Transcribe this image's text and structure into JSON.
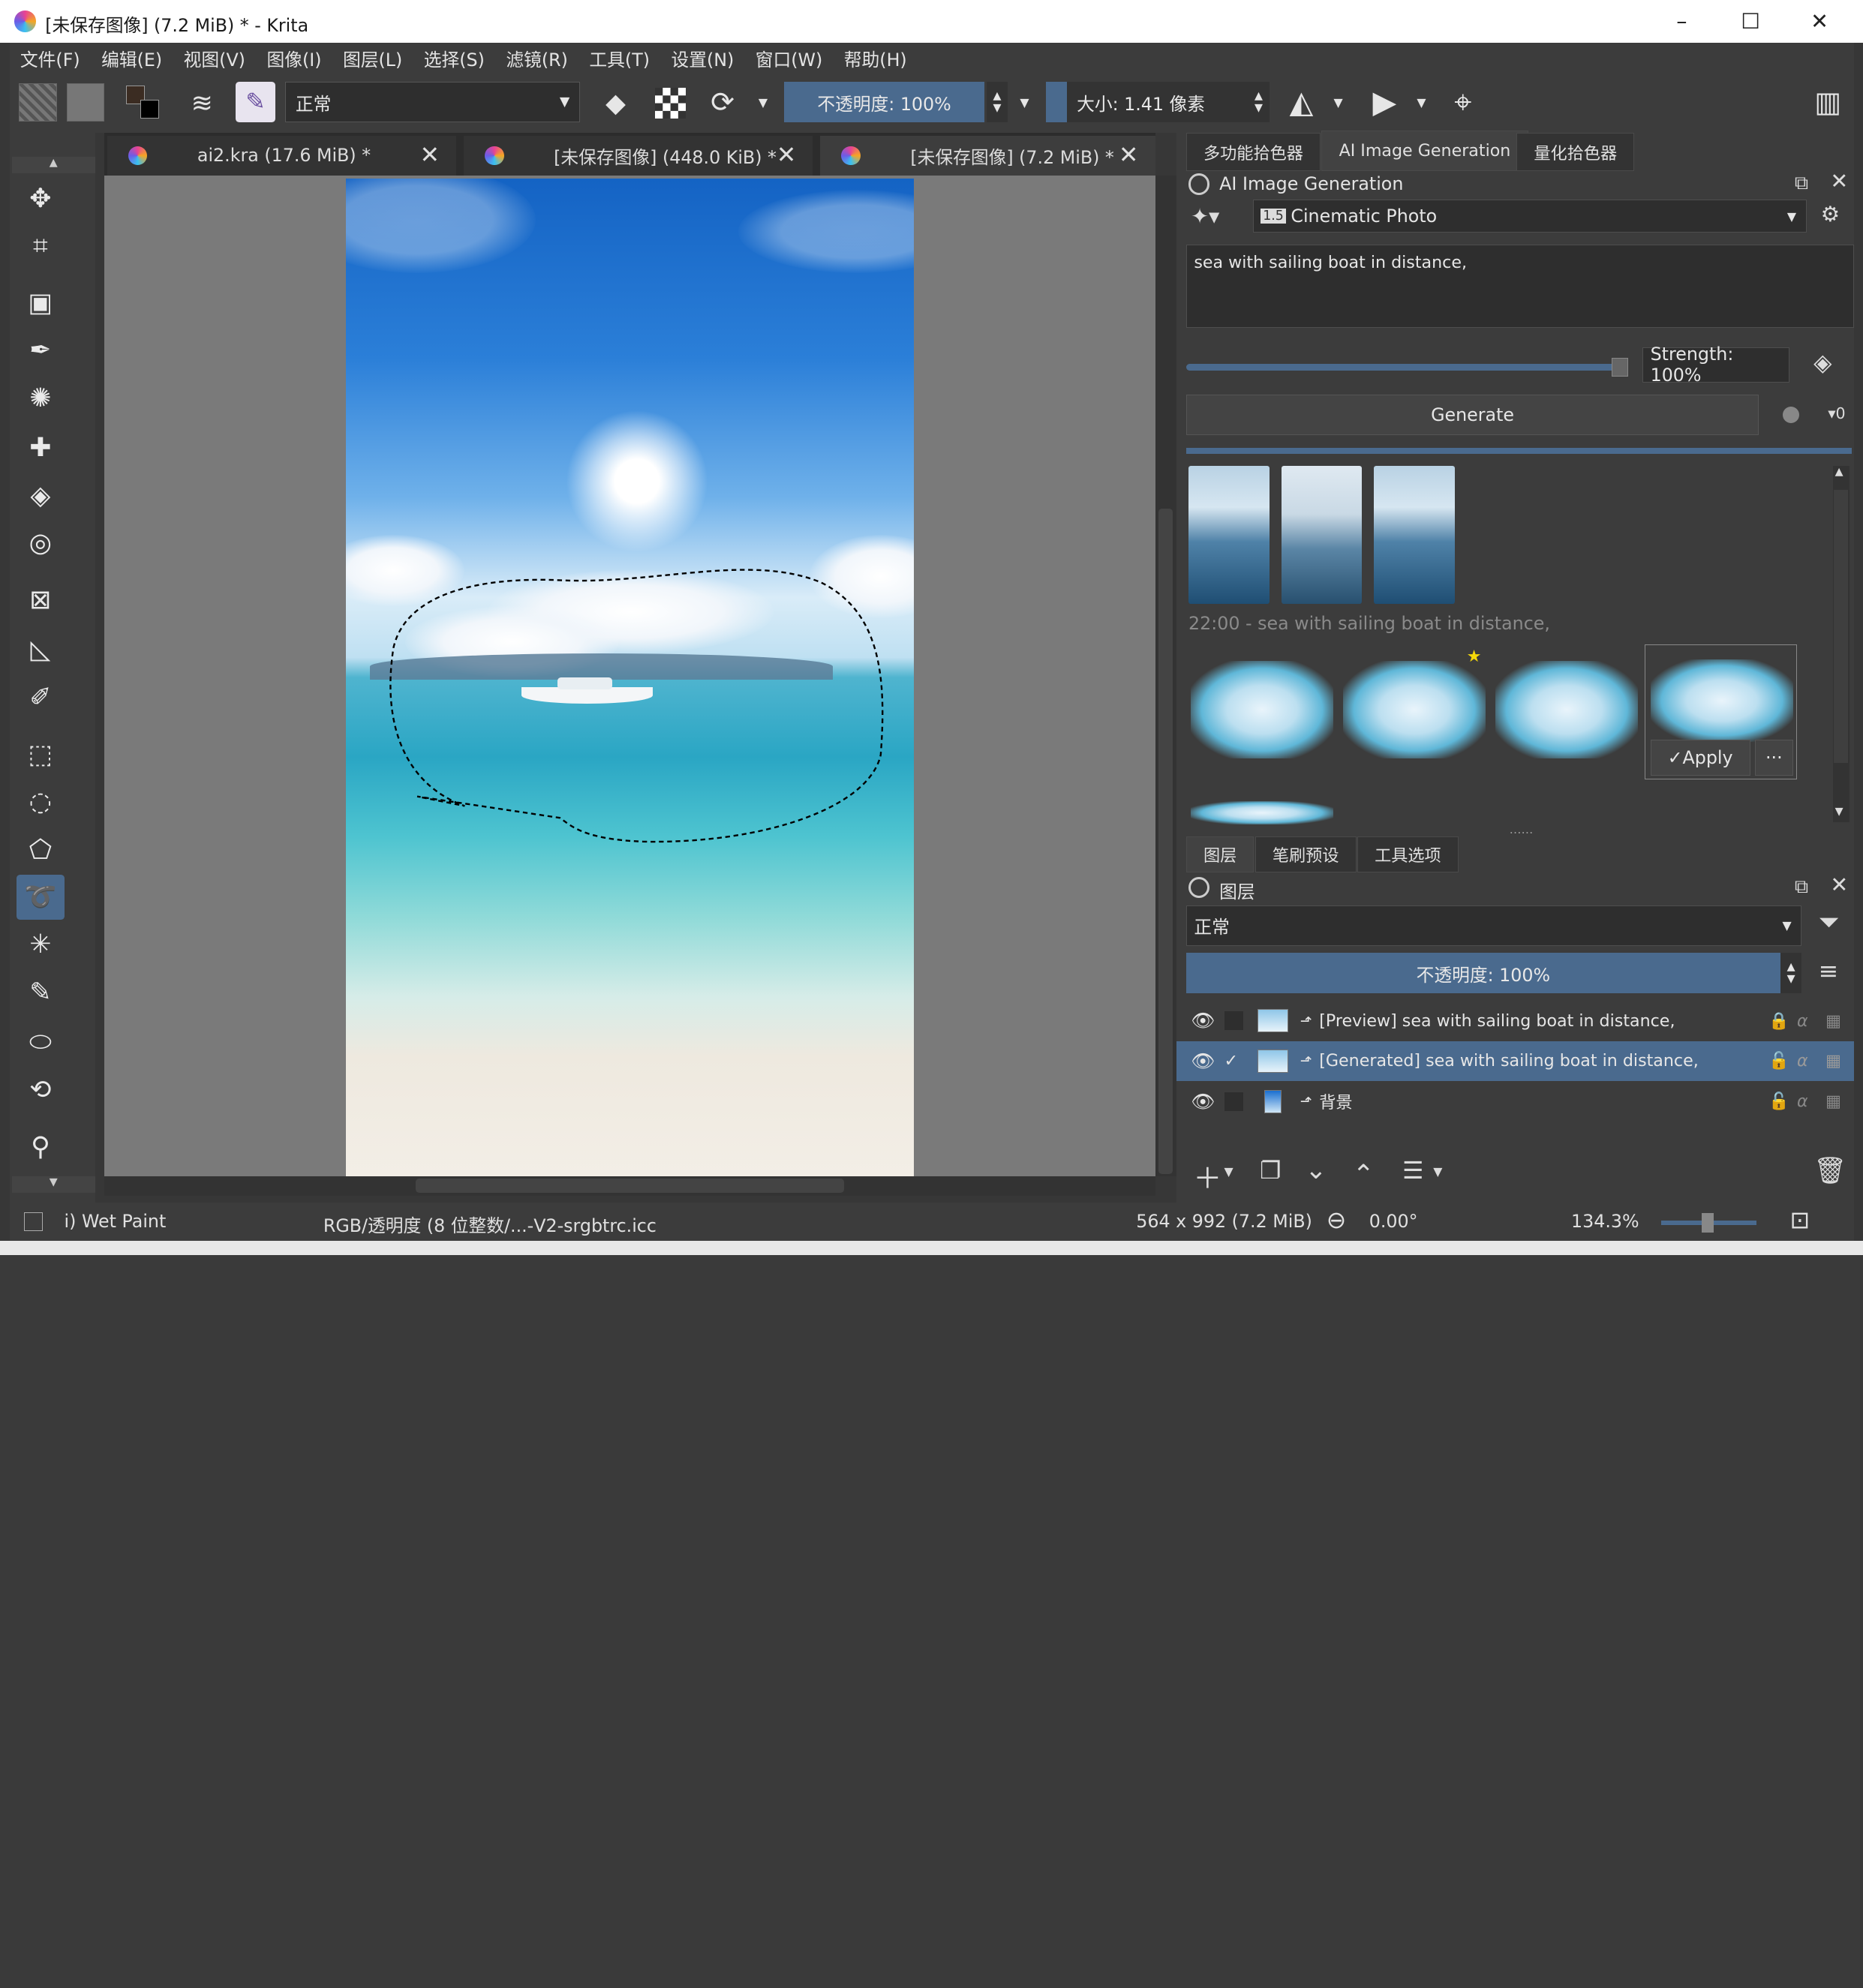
{
  "window": {
    "title": "[未保存图像]  (7.2 MiB) * - Krita",
    "min": "–",
    "max": "☐",
    "close": "✕"
  },
  "menu": [
    "文件(F)",
    "编辑(E)",
    "视图(V)",
    "图像(I)",
    "图层(L)",
    "选择(S)",
    "滤镜(R)",
    "工具(T)",
    "设置(N)",
    "窗口(W)",
    "帮助(H)"
  ],
  "toolbar": {
    "blend_mode": "正常",
    "opacity_label": "不透明度:  100%",
    "size_label": "大小:  1.41 像素"
  },
  "doc_tabs": [
    {
      "label": "ai2.kra (17.6 MiB) *"
    },
    {
      "label": "[未保存图像]  (448.0 KiB) *"
    },
    {
      "label": "[未保存图像]  (7.2 MiB) *"
    }
  ],
  "right_tabs": [
    "多功能拾色器",
    "AI Image Generation",
    "量化拾色器"
  ],
  "ai_panel": {
    "title": "AI Image Generation",
    "style_badge": "1.5",
    "style": "Cinematic Photo",
    "prompt": "sea with sailing boat in distance,",
    "strength": "Strength: 100%",
    "generate": "Generate",
    "queue": "0",
    "history_caption": "22:00 - sea with sailing boat in distance,",
    "apply": "Apply",
    "more": "···"
  },
  "layer_tabs": [
    "图层",
    "笔刷预设",
    "工具选项"
  ],
  "layers_panel": {
    "title": "图层",
    "blend": "正常",
    "opacity": "不透明度:  100%",
    "layers": [
      {
        "name": "[Preview] sea with sailing boat in distance,",
        "checked": false,
        "selected": false
      },
      {
        "name": "[Generated] sea with sailing boat in distance,",
        "checked": true,
        "selected": true
      },
      {
        "name": "背景",
        "checked": false,
        "selected": false
      }
    ]
  },
  "status": {
    "brush": "i) Wet Paint",
    "colorspace": "RGB/透明度 (8 位整数/...-V2-srgbtrc.icc",
    "dims": "564 x 992 (7.2 MiB)",
    "rotation": "0.00°",
    "zoom": "134.3%"
  },
  "colors": {
    "accent": "#4a6a8e",
    "panel": "#3c3c3c",
    "star": "#f5d90a"
  }
}
